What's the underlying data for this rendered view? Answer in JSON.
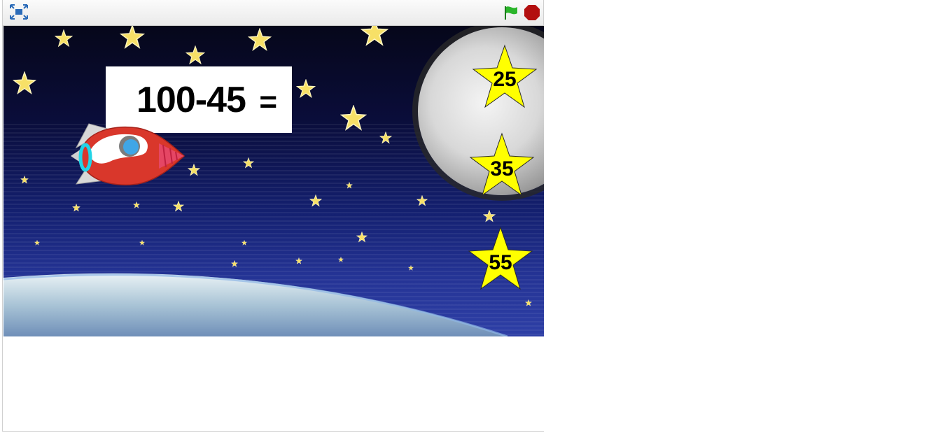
{
  "toolbar": {
    "fullscreen_icon": "fullscreen-icon",
    "flag_icon": "green-flag-icon",
    "stop_icon": "stop-icon",
    "flag_color": "#2bb52b",
    "stop_color": "#b30f0f"
  },
  "question": {
    "expression": "100-45",
    "equals": "="
  },
  "answers": [
    {
      "label": "25"
    },
    {
      "label": "35"
    },
    {
      "label": "55"
    }
  ],
  "colors": {
    "answer_star": "#ffff00",
    "rocket_body": "#d9372b",
    "rocket_ring": "#22d4e6"
  }
}
